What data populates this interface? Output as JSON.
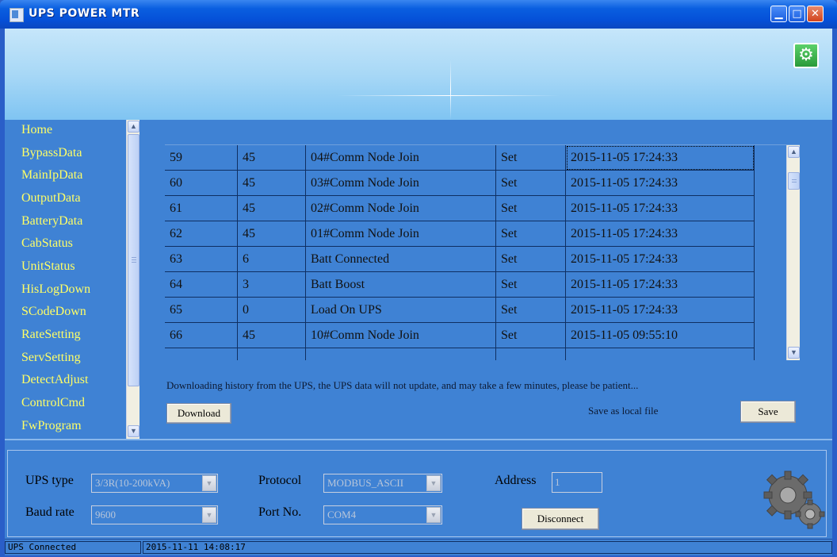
{
  "window": {
    "title": "UPS POWER MTR",
    "minimize_glyph": "▁",
    "maximize_glyph": "□",
    "close_glyph": "✕",
    "settings_icon": "gear-icon"
  },
  "sidebar": {
    "items": [
      {
        "label": "Home"
      },
      {
        "label": "BypassData"
      },
      {
        "label": "MainIpData"
      },
      {
        "label": "OutputData"
      },
      {
        "label": "BatteryData"
      },
      {
        "label": "CabStatus"
      },
      {
        "label": "UnitStatus"
      },
      {
        "label": "HisLogDown"
      },
      {
        "label": "SCodeDown"
      },
      {
        "label": "RateSetting"
      },
      {
        "label": "ServSetting"
      },
      {
        "label": "DetectAdjust"
      },
      {
        "label": "ControlCmd"
      },
      {
        "label": "FwProgram"
      }
    ]
  },
  "log_table": {
    "rows": [
      {
        "index": "59",
        "code": "45",
        "event": "04#Comm Node Join",
        "state": "Set",
        "time": "2015-11-05 17:24:33"
      },
      {
        "index": "60",
        "code": "45",
        "event": "03#Comm Node Join",
        "state": "Set",
        "time": "2015-11-05 17:24:33"
      },
      {
        "index": "61",
        "code": "45",
        "event": "02#Comm Node Join",
        "state": "Set",
        "time": "2015-11-05 17:24:33"
      },
      {
        "index": "62",
        "code": "45",
        "event": "01#Comm Node Join",
        "state": "Set",
        "time": "2015-11-05 17:24:33"
      },
      {
        "index": "63",
        "code": "6",
        "event": "Batt Connected",
        "state": "Set",
        "time": "2015-11-05 17:24:33"
      },
      {
        "index": "64",
        "code": "3",
        "event": "Batt Boost",
        "state": "Set",
        "time": "2015-11-05 17:24:33"
      },
      {
        "index": "65",
        "code": "0",
        "event": "Load On UPS",
        "state": "Set",
        "time": "2015-11-05 17:24:33"
      },
      {
        "index": "66",
        "code": "45",
        "event": "10#Comm Node Join",
        "state": "Set",
        "time": "2015-11-05 09:55:10"
      }
    ]
  },
  "history": {
    "notice": "Downloading history from the UPS, the UPS data will not update, and may take a few minutes, please be patient...",
    "download_label": "Download",
    "save_as_label": "Save as local file",
    "save_label": "Save"
  },
  "connection": {
    "ups_type_label": "UPS type",
    "ups_type_value": "3/3R(10-200kVA)",
    "baud_rate_label": "Baud rate",
    "baud_rate_value": "9600",
    "protocol_label": "Protocol",
    "protocol_value": "MODBUS_ASCII",
    "port_label": "Port No.",
    "port_value": "COM4",
    "address_label": "Address",
    "address_value": "1",
    "disconnect_label": "Disconnect"
  },
  "status_bar": {
    "state": "UPS Connected",
    "timestamp": "2015-11-11 14:08:17"
  }
}
